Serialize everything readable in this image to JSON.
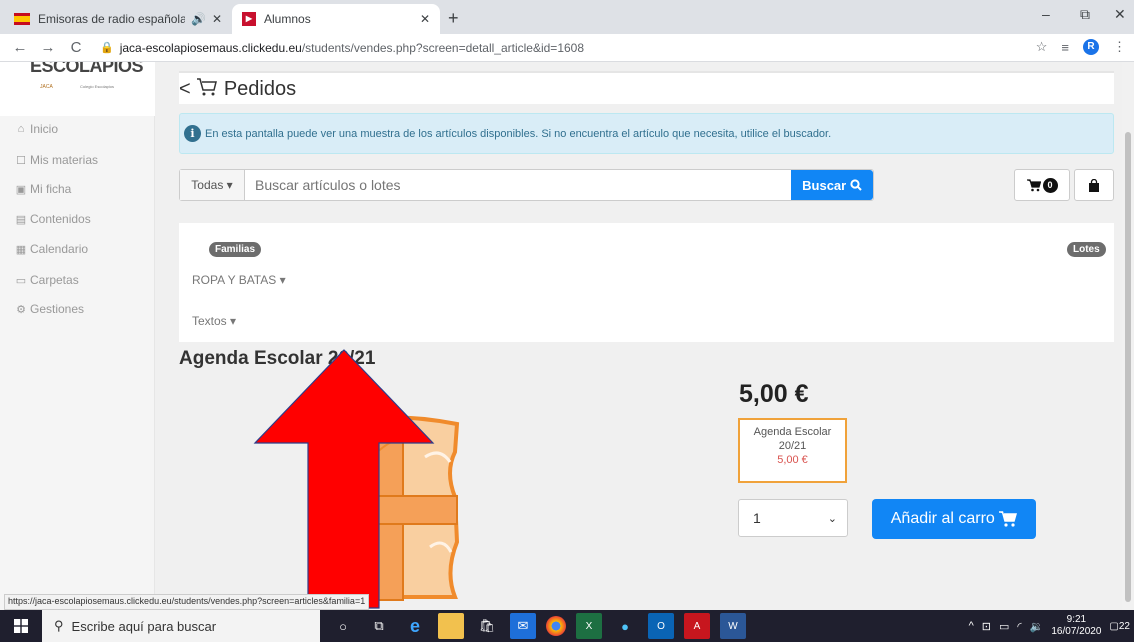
{
  "browser": {
    "tabs": [
      {
        "label": "Emisoras de radio españolas",
        "audio_icon": "🔊"
      },
      {
        "label": "Alumnos"
      }
    ],
    "new_tab": "+",
    "url_host": "jaca-escolapiosemaus.clickedu.eu",
    "url_path": "/students/vendes.php?screen=detall_article&id=1608",
    "avatar": "R",
    "controls": {
      "minimize": "–",
      "maximize": "⧉",
      "close": "✕",
      "close_tab": "✕"
    }
  },
  "sidebar": {
    "logo_text": "ESCOLAPIOS",
    "logo_sub": "JACA",
    "logo_sub2": "Colegio Escolapios",
    "items": [
      {
        "label": "Inicio",
        "icon": "⌂"
      },
      {
        "label": "Mis materias",
        "icon": "☐"
      },
      {
        "label": "Mi ficha",
        "icon": "▣"
      },
      {
        "label": "Contenidos",
        "icon": "▤"
      },
      {
        "label": "Calendario",
        "icon": "▦"
      },
      {
        "label": "Carpetas",
        "icon": "▭"
      },
      {
        "label": "Gestiones",
        "icon": "⚙"
      }
    ]
  },
  "header": {
    "back": "<",
    "title": "Pedidos"
  },
  "info": {
    "icon": "i",
    "text": "En esta pantalla puede ver una muestra de los artículos disponibles. Si no encuentra el artículo que necesita, utilice el buscador."
  },
  "search": {
    "filter": "Todas",
    "placeholder": "Buscar artículos o lotes",
    "button": "Buscar"
  },
  "cart": {
    "count": "0"
  },
  "families": {
    "families_pill": "Familias",
    "lots_pill": "Lotes",
    "items": [
      "ROPA Y BATAS",
      "Textos"
    ]
  },
  "product": {
    "title": "Agenda Escolar 20/21",
    "price": "5,00 €",
    "variant_name": "Agenda Escolar 20/21",
    "variant_price": "5,00 €",
    "quantity": "1",
    "add_button": "Añadir al carro"
  },
  "status_url": "https://jaca-escolapiosemaus.clickedu.eu/students/vendes.php?screen=articles&familia=1",
  "taskbar": {
    "search_text": "Escribe aquí para buscar",
    "time": "9:21",
    "date": "16/07/2020",
    "notifications": "22"
  },
  "colors": {
    "accent": "#1186f5",
    "arrow": "#ff0000",
    "info_bg": "#d9edf7",
    "variant_border": "#f0a23a"
  }
}
